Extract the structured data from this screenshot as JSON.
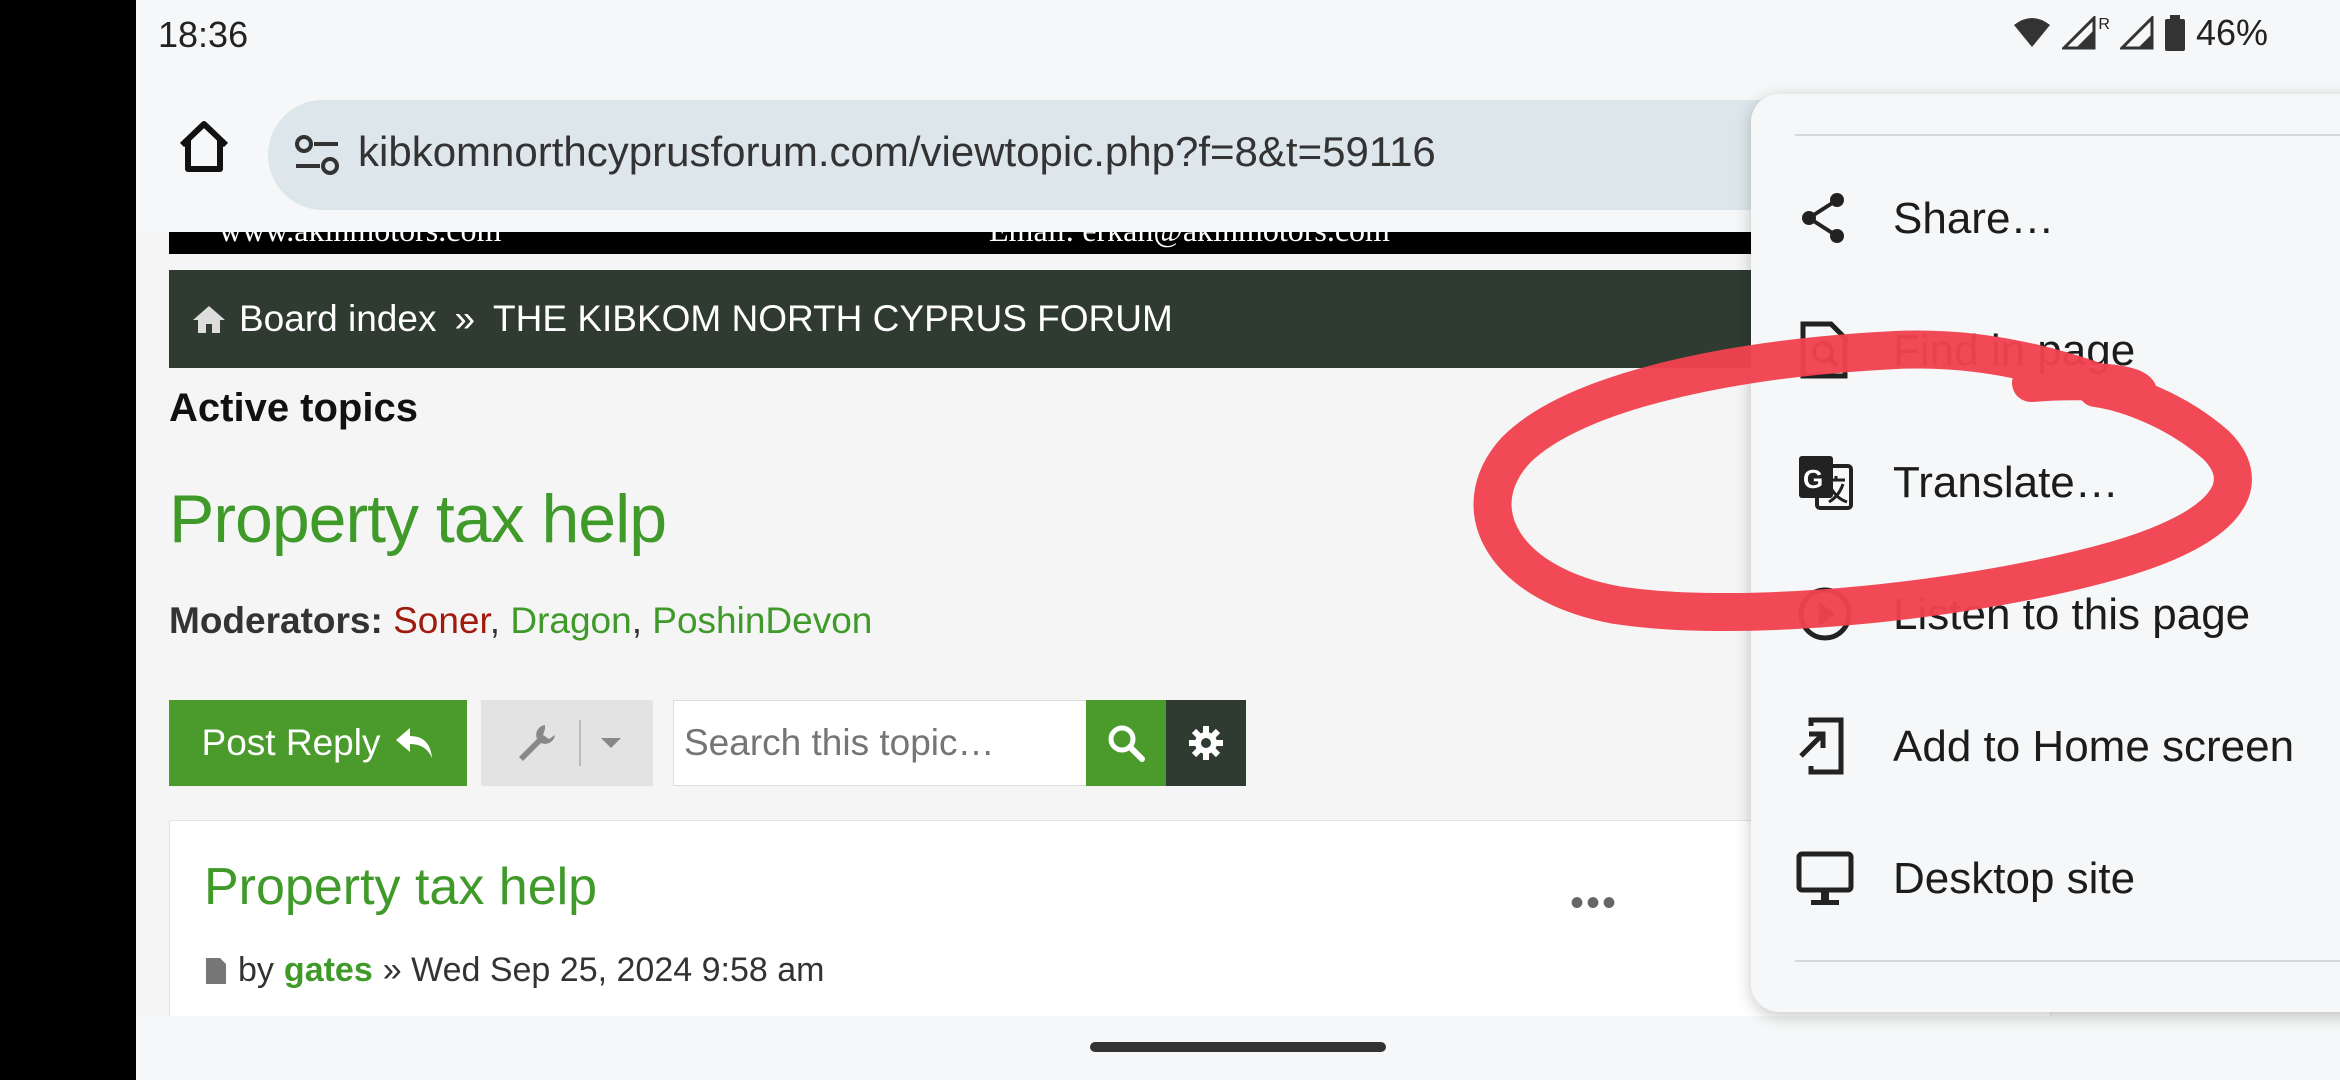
{
  "status_bar": {
    "time": "18:36",
    "battery": "46%",
    "roaming": "R"
  },
  "browser": {
    "url": "kibkomnorthcyprusforum.com/viewtopic.php?f=8&t=59116"
  },
  "banner": {
    "left_text": "www.akinmotors.com",
    "right_text": "Email: erkan@akinmotors.com"
  },
  "breadcrumb": {
    "home": "Board index",
    "separator": "»",
    "forum": "THE KIBKOM NORTH CYPRUS FORUM"
  },
  "page": {
    "active_topics": "Active topics",
    "topic_title": "Property tax help",
    "moderators_label": "Moderators:",
    "moderators": [
      "Soner",
      "Dragon",
      "PoshinDevon"
    ],
    "comma": ","
  },
  "actions": {
    "post_reply": "Post Reply",
    "search_placeholder": "Search this topic…"
  },
  "post": {
    "title": "Property tax help",
    "menu": "•••",
    "by": "by",
    "author": "gates",
    "date": "» Wed Sep 25, 2024 9:58 am"
  },
  "menu": {
    "items": [
      {
        "label": "Share…",
        "icon": "share-icon"
      },
      {
        "label": "Find in page",
        "icon": "find-in-page-icon"
      },
      {
        "label": "Translate…",
        "icon": "translate-icon"
      },
      {
        "label": "Listen to this page",
        "icon": "listen-icon"
      },
      {
        "label": "Add to Home screen",
        "icon": "add-to-home-icon"
      },
      {
        "label": "Desktop site",
        "icon": "desktop-icon"
      }
    ]
  },
  "colors": {
    "forum_green": "#3f9a2a",
    "nav_dark": "#2f3a31",
    "annotation_red": "#f0434f",
    "whatsapp_green": "#5bcc6a"
  }
}
